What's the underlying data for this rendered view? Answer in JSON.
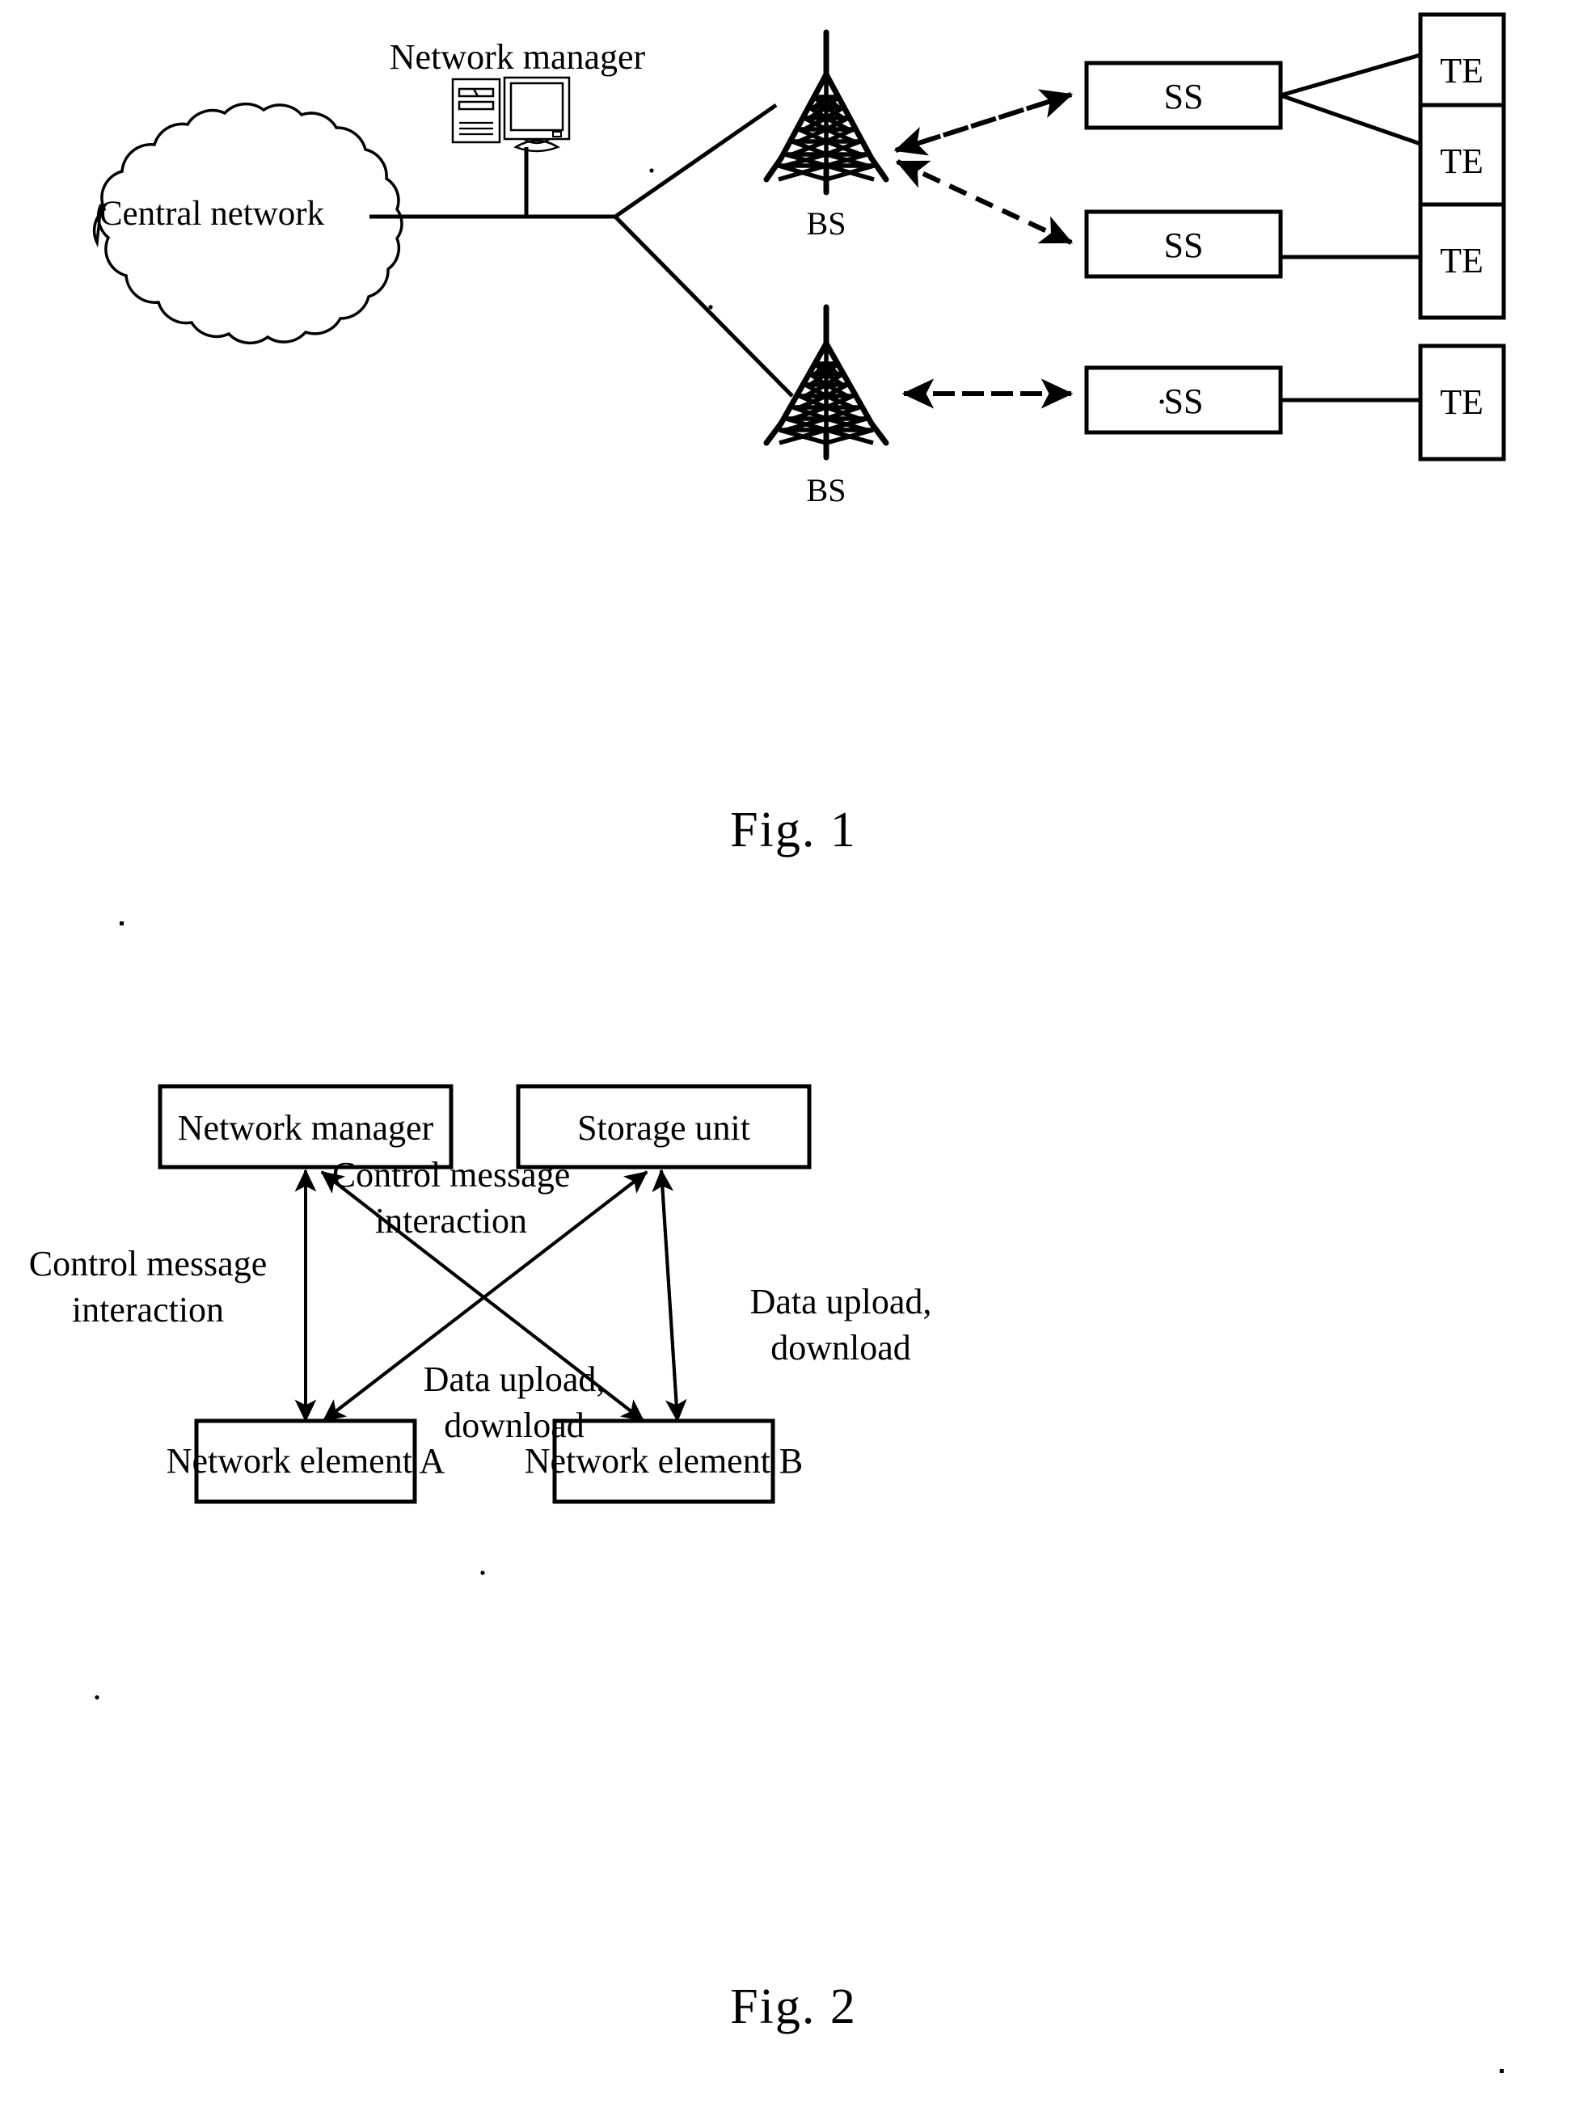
{
  "figures": [
    {
      "id": "fig1",
      "caption": "Fig. 1",
      "nodes": {
        "central_network": "Central network",
        "network_manager": "Network manager",
        "bs_top": "BS",
        "bs_bottom": "BS",
        "ss_1": "SS",
        "ss_2": "SS",
        "ss_3": "SS",
        "te_1": "TE",
        "te_2": "TE",
        "te_3": "TE",
        "te_4": "TE"
      },
      "icons": {
        "computer": "computer-workstation-icon",
        "tower": "radio-tower-icon",
        "cloud": "network-cloud-icon"
      }
    },
    {
      "id": "fig2",
      "caption": "Fig. 2",
      "boxes": {
        "network_manager": "Network manager",
        "storage_unit": "Storage unit",
        "network_element_a": "Network element A",
        "network_element_b": "Network element B"
      },
      "arrow_labels": {
        "control_left_line1": "Control message",
        "control_left_line2": "interaction",
        "control_center_line1": "Control message",
        "control_center_line2": "interaction",
        "data_center_line1": "Data upload,",
        "data_center_line2": "download",
        "data_right_line1": "Data upload,",
        "data_right_line2": "download"
      }
    }
  ],
  "colors": {
    "ink": "#000000",
    "paper": "#ffffff"
  }
}
